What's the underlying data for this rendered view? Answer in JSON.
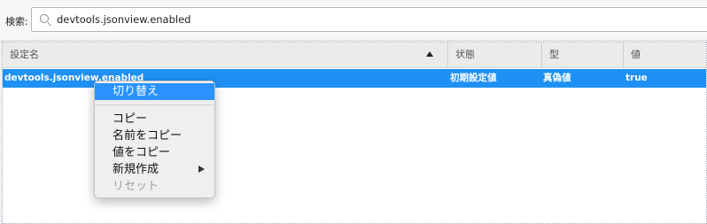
{
  "search": {
    "label": "検索:",
    "value": "devtools.jsonview.enabled"
  },
  "table": {
    "columns": [
      "設定名",
      "状態",
      "型",
      "値"
    ],
    "sort_column": "設定名",
    "sort_direction": "ascending",
    "rows": [
      {
        "name": "devtools.jsonview.enabled",
        "status": "初期設定値",
        "type": "真偽値",
        "value": "true",
        "selected": true
      }
    ]
  },
  "context_menu": {
    "items": [
      {
        "label": "切り替え",
        "highlighted": true,
        "disabled": false
      },
      {
        "label": "コピー",
        "highlighted": false,
        "disabled": false
      },
      {
        "label": "名前をコピー",
        "highlighted": false,
        "disabled": false
      },
      {
        "label": "値をコピー",
        "highlighted": false,
        "disabled": false
      },
      {
        "label": "新規作成",
        "highlighted": false,
        "disabled": false,
        "submenu": true
      },
      {
        "label": "リセット",
        "highlighted": false,
        "disabled": true
      }
    ]
  },
  "colors": {
    "selection": "#1f90f4",
    "menu_highlight": "#2a93ff"
  },
  "icons": {
    "search": "search-icon",
    "sort": "sort-ascending-icon",
    "submenu": "submenu-arrow-icon"
  }
}
